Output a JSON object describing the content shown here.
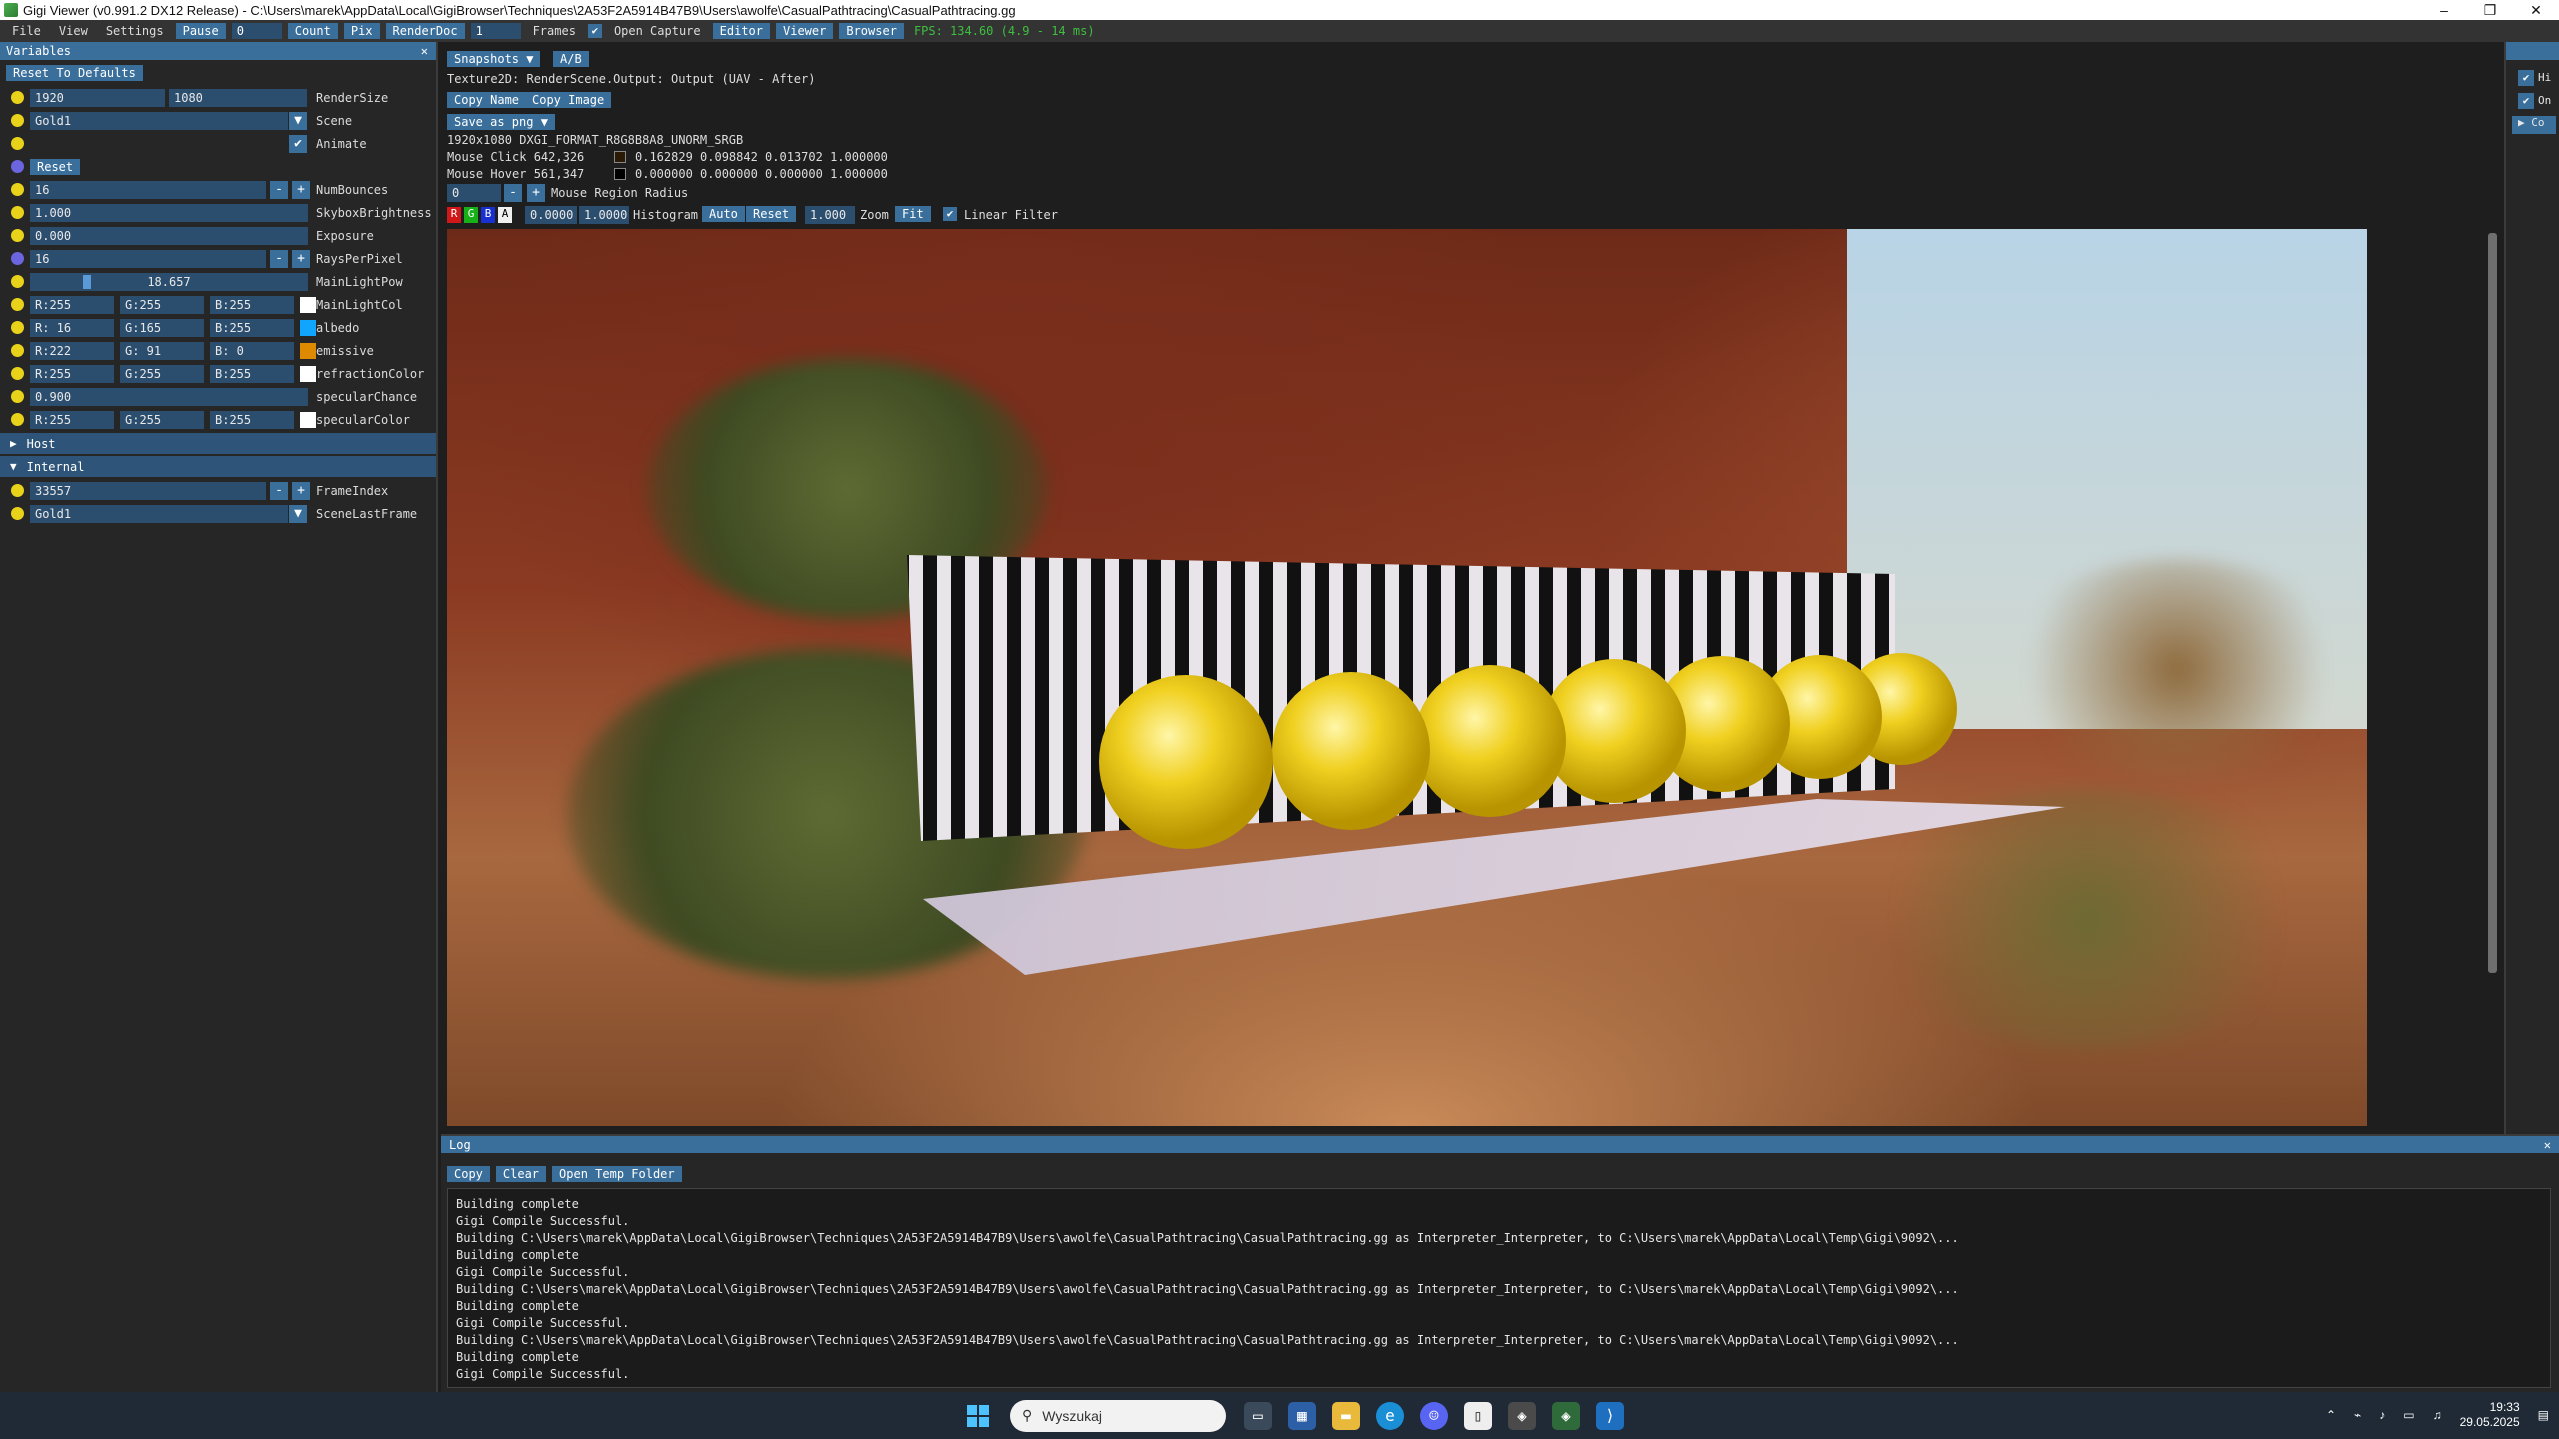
{
  "window": {
    "title": "Gigi Viewer (v0.991.2 DX12 Release) - C:\\Users\\marek\\AppData\\Local\\GigiBrowser\\Techniques\\2A53F2A5914B47B9\\Users\\awolfe\\CasualPathtracing\\CasualPathtracing.gg",
    "min": "–",
    "max": "❐",
    "close": "✕"
  },
  "menu": {
    "file": "File",
    "view": "View",
    "settings": "Settings",
    "pause": "Pause",
    "frame_count_value": "0",
    "count": "Count",
    "pix": "Pix",
    "renderdoc": "RenderDoc",
    "frames_value": "1",
    "frames": "Frames",
    "open_capture": "Open Capture",
    "editor": "Editor",
    "viewer": "Viewer",
    "browser": "Browser",
    "fps": "FPS: 134.60 (4.9 - 14 ms)"
  },
  "variables": {
    "title": "Variables",
    "close": "✕",
    "reset_defaults": "Reset To Defaults",
    "rendersize": {
      "w": "1920",
      "h": "1080",
      "label": "RenderSize"
    },
    "scene": {
      "value": "Gold1",
      "label": "Scene"
    },
    "animate": {
      "label": "Animate"
    },
    "reset": "Reset",
    "numbounces": {
      "value": "16",
      "label": "NumBounces"
    },
    "skybox": {
      "value": "1.000",
      "label": "SkyboxBrightness"
    },
    "exposure": {
      "value": "0.000",
      "label": "Exposure"
    },
    "rays": {
      "value": "16",
      "label": "RaysPerPixel"
    },
    "mainlightpow": {
      "value": "18.657",
      "label": "MainLightPow"
    },
    "mainlightcol": {
      "r": "R:255",
      "g": "G:255",
      "b": "B:255",
      "label": "MainLightCol",
      "color": "#ffffff"
    },
    "albedo": {
      "r": "R: 16",
      "g": "G:165",
      "b": "B:255",
      "label": "albedo",
      "color": "#10a5ff"
    },
    "emissive": {
      "r": "R:222",
      "g": "G: 91",
      "b": "B:  0",
      "label": "emissive",
      "color": "#de5b00"
    },
    "refraction": {
      "r": "R:255",
      "g": "G:255",
      "b": "B:255",
      "label": "refractionColor",
      "color": "#ffffff"
    },
    "specchance": {
      "value": "0.900",
      "label": "specularChance"
    },
    "speccolor": {
      "r": "R:255",
      "g": "G:255",
      "b": "B:255",
      "label": "specularColor",
      "color": "#ffffff"
    },
    "host": "Host",
    "internal": "Internal",
    "frameindex": {
      "value": "33557",
      "label": "FrameIndex"
    },
    "scenelast": {
      "value": "Gold1",
      "label": "SceneLastFrame"
    },
    "minus": "-",
    "plus": "+",
    "dropdown": "▼",
    "check": "✔"
  },
  "viewer": {
    "snapshots": "Snapshots",
    "ab": "A/B",
    "texture_line": "Texture2D: RenderScene.Output: Output (UAV - After)",
    "copy_name": "Copy Name",
    "copy_image": "Copy Image",
    "save_as": "Save as png",
    "size_format": "1920x1080    DXGI_FORMAT_R8G8B8A8_UNORM_SRGB",
    "mouse_click": "Mouse Click 642,326",
    "mouse_click_vals": "0.162829 0.098842 0.013702 1.000000",
    "mouse_hover": "Mouse Hover 561,347",
    "mouse_hover_vals": "0.000000 0.000000 0.000000 1.000000",
    "radius_value": "0",
    "radius_label": "Mouse Region Radius",
    "ch_r": "R",
    "ch_g": "G",
    "ch_b": "B",
    "ch_a": "A",
    "hist_min": "0.0000",
    "hist_max": "1.0000",
    "histogram": "Histogram",
    "auto": "Auto",
    "reset": "Reset",
    "zoom_value": "1.000",
    "zoom": "Zoom",
    "fit": "Fit",
    "linear_filter": "Linear Filter"
  },
  "right_panel": {
    "hi": "Hi",
    "on": "On",
    "co": "Co"
  },
  "log": {
    "title": "Log",
    "copy": "Copy",
    "clear": "Clear",
    "open_temp": "Open Temp Folder",
    "lines": [
      "Building complete",
      "Gigi Compile Successful.",
      "Building C:\\Users\\marek\\AppData\\Local\\GigiBrowser\\Techniques\\2A53F2A5914B47B9\\Users\\awolfe\\CasualPathtracing\\CasualPathtracing.gg as Interpreter_Interpreter, to C:\\Users\\marek\\AppData\\Local\\Temp\\Gigi\\9092\\...",
      "Building complete",
      "Gigi Compile Successful.",
      "Building C:\\Users\\marek\\AppData\\Local\\GigiBrowser\\Techniques\\2A53F2A5914B47B9\\Users\\awolfe\\CasualPathtracing\\CasualPathtracing.gg as Interpreter_Interpreter, to C:\\Users\\marek\\AppData\\Local\\Temp\\Gigi\\9092\\...",
      "Building complete",
      "Gigi Compile Successful.",
      "Building C:\\Users\\marek\\AppData\\Local\\GigiBrowser\\Techniques\\2A53F2A5914B47B9\\Users\\awolfe\\CasualPathtracing\\CasualPathtracing.gg as Interpreter_Interpreter, to C:\\Users\\marek\\AppData\\Local\\Temp\\Gigi\\9092\\...",
      "Building complete",
      "Gigi Compile Successful."
    ]
  },
  "taskbar": {
    "search": "Wyszukaj",
    "time": "19:33",
    "date": "29.05.2025"
  },
  "colors": {
    "accent": "#3a6f9c",
    "dot": "#e9d21a",
    "fps": "#3fbf3f"
  }
}
